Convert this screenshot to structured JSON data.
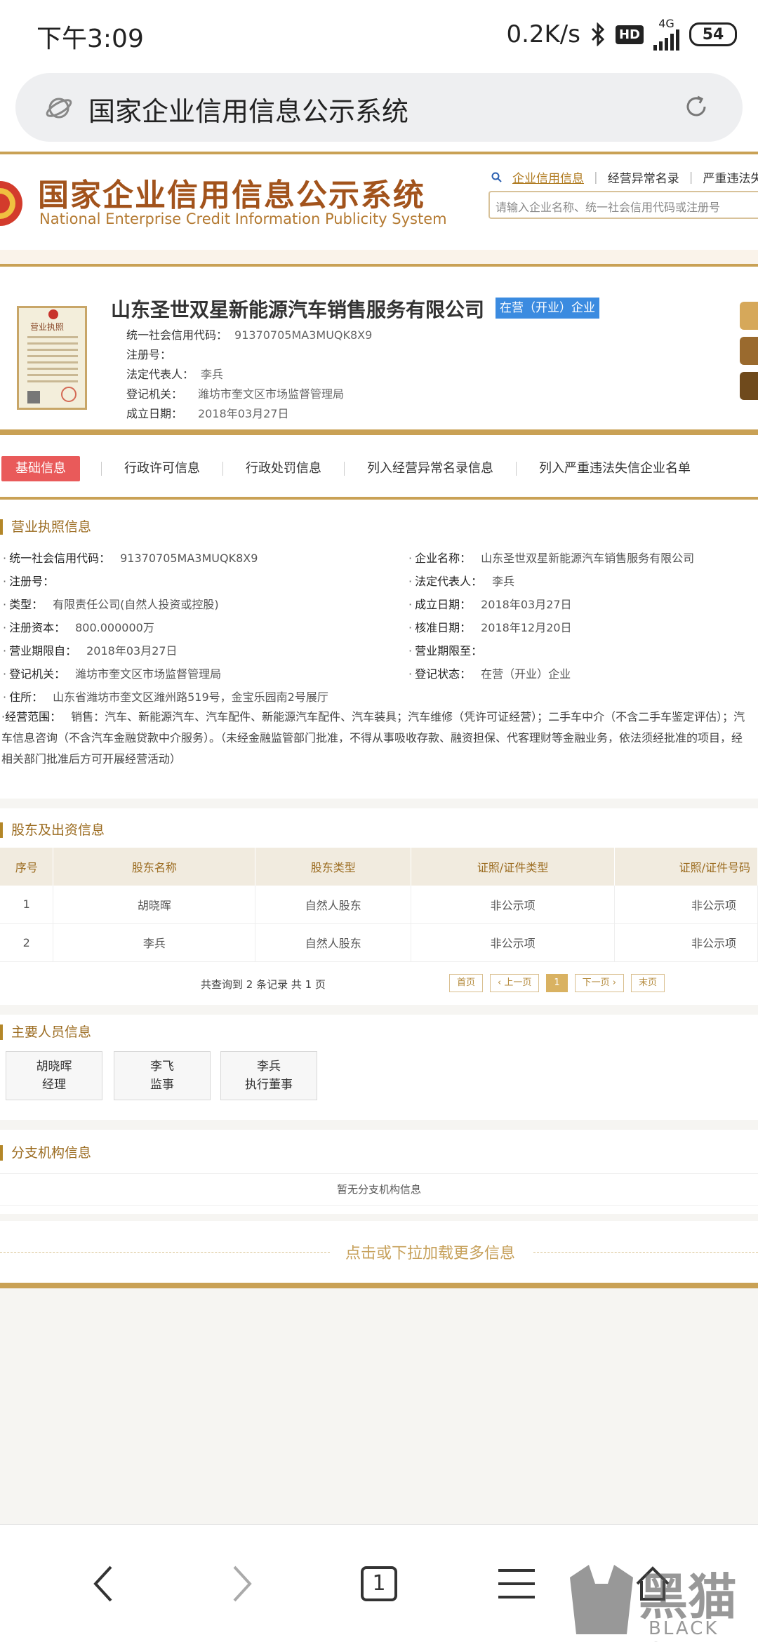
{
  "status_bar": {
    "time": "下午3:09",
    "speed": "0.2K/s",
    "hd": "HD",
    "network": "4G",
    "battery": "54"
  },
  "browser": {
    "url_text": "国家企业信用信息公示系统"
  },
  "site": {
    "title": "国家企业信用信息公示系统",
    "subtitle": "National Enterprise Credit Information Publicity System",
    "nav": [
      "企业信用信息",
      "经营异常名录",
      "严重违法失信"
    ],
    "search_placeholder": "请输入企业名称、统一社会信用代码或注册号"
  },
  "company": {
    "license_label": "营业执照",
    "name": "山东圣世双星新能源汽车销售服务有限公司",
    "status": "在营（开业）企业",
    "fields": [
      {
        "label": "统一社会信用代码：",
        "value": "91370705MA3MUQK8X9"
      },
      {
        "label": "注册号：",
        "value": ""
      },
      {
        "label": "法定代表人：",
        "value": "李兵"
      },
      {
        "label": "登记机关：",
        "value": "潍坊市奎文区市场监督管理局"
      },
      {
        "label": "成立日期：",
        "value": "2018年03月27日"
      }
    ]
  },
  "tabs": [
    "基础信息",
    "行政许可信息",
    "行政处罚信息",
    "列入经营异常名录信息",
    "列入严重违法失信企业名单"
  ],
  "business_license": {
    "title": "营业执照信息",
    "left": [
      {
        "label": "统一社会信用代码：",
        "value": "91370705MA3MUQK8X9"
      },
      {
        "label": "注册号：",
        "value": ""
      },
      {
        "label": "类型：",
        "value": "有限责任公司(自然人投资或控股)"
      },
      {
        "label": "注册资本：",
        "value": "800.000000万"
      },
      {
        "label": "营业期限自：",
        "value": "2018年03月27日"
      },
      {
        "label": "登记机关：",
        "value": "潍坊市奎文区市场监督管理局"
      },
      {
        "label": "住所：",
        "value": "山东省潍坊市奎文区潍州路519号，金宝乐园南2号展厅"
      }
    ],
    "right": [
      {
        "label": "企业名称：",
        "value": "山东圣世双星新能源汽车销售服务有限公司"
      },
      {
        "label": "法定代表人：",
        "value": "李兵"
      },
      {
        "label": "成立日期：",
        "value": "2018年03月27日"
      },
      {
        "label": "核准日期：",
        "value": "2018年12月20日"
      },
      {
        "label": "营业期限至：",
        "value": ""
      },
      {
        "label": "登记状态：",
        "value": "在营（开业）企业"
      }
    ],
    "scope_label": "经营范围：",
    "scope_value": "销售：汽车、新能源汽车、汽车配件、新能源汽车配件、汽车装具；汽车维修（凭许可证经营）；二手车中介（不含二手车鉴定评估）；汽车信息咨询（不含汽车金融贷款中介服务）。（未经金融监管部门批准，不得从事吸收存款、融资担保、代客理财等金融业务，依法须经批准的项目，经相关部门批准后方可开展经营活动）"
  },
  "shareholders": {
    "title": "股东及出资信息",
    "headers": [
      "序号",
      "股东名称",
      "股东类型",
      "证照/证件类型",
      "证照/证件号码"
    ],
    "rows": [
      [
        "1",
        "胡晓晖",
        "自然人股东",
        "非公示项",
        "非公示项"
      ],
      [
        "2",
        "李兵",
        "自然人股东",
        "非公示项",
        "非公示项"
      ]
    ],
    "summary": "共查询到 2 条记录 共 1 页",
    "pager": [
      "首页",
      "‹ 上一页",
      "1",
      "下一页 ›",
      "末页"
    ]
  },
  "personnel": {
    "title": "主要人员信息",
    "people": [
      {
        "name": "胡晓晖",
        "role": "经理"
      },
      {
        "name": "李飞",
        "role": "监事"
      },
      {
        "name": "李兵",
        "role": "执行董事"
      }
    ]
  },
  "branches": {
    "title": "分支机构信息",
    "empty": "暂无分支机构信息"
  },
  "load_more": "点击或下拉加载更多信息",
  "bottom_nav": {
    "tab_count": "1"
  },
  "watermark": {
    "text": "黑猫",
    "sub": "BLACK CAT"
  }
}
